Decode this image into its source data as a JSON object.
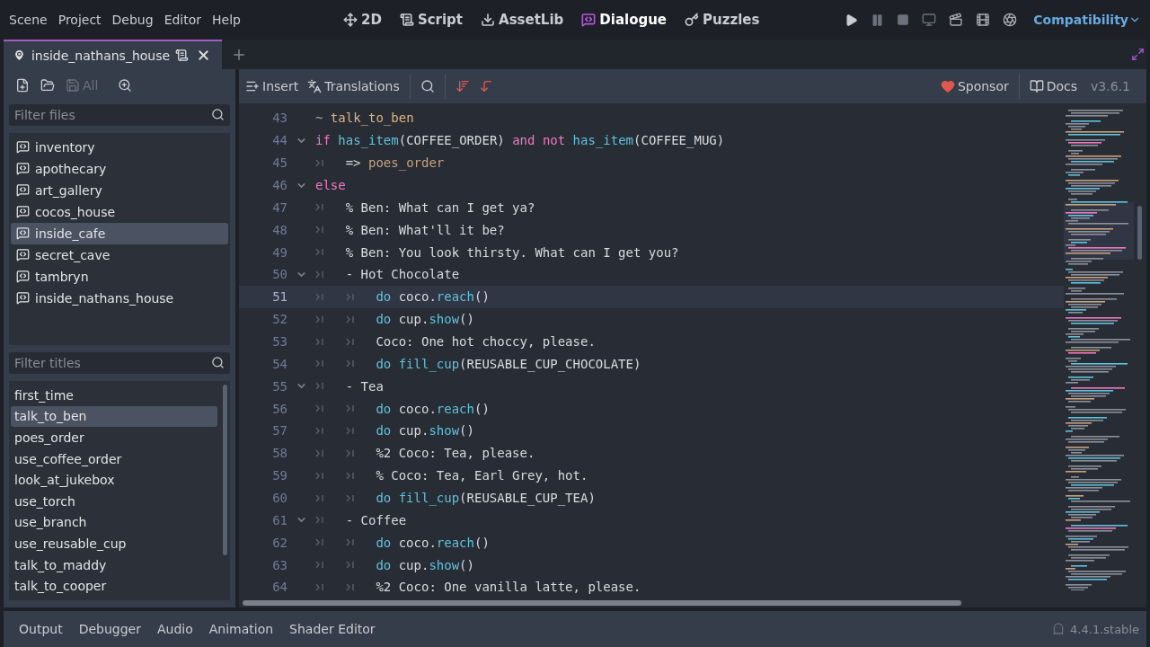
{
  "menu": [
    "Scene",
    "Project",
    "Debug",
    "Editor",
    "Help"
  ],
  "workspaces": [
    {
      "label": "2D",
      "kind": "plane",
      "selected": false
    },
    {
      "label": "Script",
      "kind": "script",
      "selected": false
    },
    {
      "label": "AssetLib",
      "kind": "assetlib",
      "selected": false
    },
    {
      "label": "Dialogue",
      "kind": "dialogue",
      "selected": true
    },
    {
      "label": "Puzzles",
      "kind": "puzzles",
      "selected": false
    }
  ],
  "renderer": "Compatibility",
  "open_tab": {
    "label": "inside_nathans_house"
  },
  "file_toolbar": {
    "save_all": {
      "label": "All",
      "disabled": true
    }
  },
  "files_filter": {
    "placeholder": "Filter files"
  },
  "files": [
    {
      "label": "inventory",
      "selected": false
    },
    {
      "label": "apothecary",
      "selected": false
    },
    {
      "label": "art_gallery",
      "selected": false
    },
    {
      "label": "cocos_house",
      "selected": false
    },
    {
      "label": "inside_cafe",
      "selected": true
    },
    {
      "label": "secret_cave",
      "selected": false
    },
    {
      "label": "tambryn",
      "selected": false
    },
    {
      "label": "inside_nathans_house",
      "selected": false
    }
  ],
  "titles_filter": {
    "placeholder": "Filter titles"
  },
  "titles": [
    {
      "label": "first_time",
      "selected": false
    },
    {
      "label": "talk_to_ben",
      "selected": true
    },
    {
      "label": "poes_order",
      "selected": false
    },
    {
      "label": "use_coffee_order",
      "selected": false
    },
    {
      "label": "look_at_jukebox",
      "selected": false
    },
    {
      "label": "use_torch",
      "selected": false
    },
    {
      "label": "use_branch",
      "selected": false
    },
    {
      "label": "use_reusable_cup",
      "selected": false
    },
    {
      "label": "talk_to_maddy",
      "selected": false
    },
    {
      "label": "talk_to_cooper",
      "selected": false
    }
  ],
  "editor_toolbar": {
    "insert": "Insert",
    "translations": "Translations",
    "sponsor": "Sponsor",
    "docs": "Docs",
    "version": "v3.6.1"
  },
  "lines": [
    {
      "number": "43",
      "foldable": false,
      "selected": false,
      "segments": [
        {
          "kind": "tilde",
          "text": "~ "
        },
        {
          "kind": "title",
          "text": "talk_to_ben"
        }
      ]
    },
    {
      "number": "44",
      "foldable": true,
      "selected": false,
      "segments": [
        {
          "kind": "kw",
          "text": "if "
        },
        {
          "kind": "fn",
          "text": "has_item"
        },
        {
          "kind": "text",
          "text": "(COFFEE_ORDER) "
        },
        {
          "kind": "kw",
          "text": "and not "
        },
        {
          "kind": "fn",
          "text": "has_item"
        },
        {
          "kind": "text",
          "text": "(COFFEE_MUG)"
        }
      ]
    },
    {
      "number": "45",
      "foldable": false,
      "selected": false,
      "segments": [
        {
          "kind": "tab"
        },
        {
          "kind": "text",
          "text": "=> "
        },
        {
          "kind": "goto",
          "text": "poes_order"
        }
      ]
    },
    {
      "number": "46",
      "foldable": true,
      "selected": false,
      "segments": [
        {
          "kind": "kw",
          "text": "else"
        }
      ]
    },
    {
      "number": "47",
      "foldable": false,
      "selected": false,
      "segments": [
        {
          "kind": "tab"
        },
        {
          "kind": "text",
          "text": "% Ben: What can I get ya?"
        }
      ]
    },
    {
      "number": "48",
      "foldable": false,
      "selected": false,
      "segments": [
        {
          "kind": "tab"
        },
        {
          "kind": "text",
          "text": "% Ben: What'll it be?"
        }
      ]
    },
    {
      "number": "49",
      "foldable": false,
      "selected": false,
      "segments": [
        {
          "kind": "tab"
        },
        {
          "kind": "text",
          "text": "% Ben: You look thirsty. What can I get you?"
        }
      ]
    },
    {
      "number": "50",
      "foldable": true,
      "selected": false,
      "segments": [
        {
          "kind": "tab"
        },
        {
          "kind": "text",
          "text": "- Hot Chocolate"
        }
      ]
    },
    {
      "number": "51",
      "foldable": false,
      "selected": true,
      "segments": [
        {
          "kind": "tab"
        },
        {
          "kind": "tab"
        },
        {
          "kind": "fn",
          "text": "do"
        },
        {
          "kind": "text",
          "text": " coco."
        },
        {
          "kind": "fn",
          "text": "reach"
        },
        {
          "kind": "text",
          "text": "()"
        }
      ]
    },
    {
      "number": "52",
      "foldable": false,
      "selected": false,
      "segments": [
        {
          "kind": "tab"
        },
        {
          "kind": "tab"
        },
        {
          "kind": "fn",
          "text": "do"
        },
        {
          "kind": "text",
          "text": " cup."
        },
        {
          "kind": "fn",
          "text": "show"
        },
        {
          "kind": "text",
          "text": "()"
        }
      ]
    },
    {
      "number": "53",
      "foldable": false,
      "selected": false,
      "segments": [
        {
          "kind": "tab"
        },
        {
          "kind": "tab"
        },
        {
          "kind": "text",
          "text": "Coco: One hot choccy, please."
        }
      ]
    },
    {
      "number": "54",
      "foldable": false,
      "selected": false,
      "segments": [
        {
          "kind": "tab"
        },
        {
          "kind": "tab"
        },
        {
          "kind": "fn",
          "text": "do fill_cup"
        },
        {
          "kind": "text",
          "text": "(REUSABLE_CUP_CHOCOLATE)"
        }
      ]
    },
    {
      "number": "55",
      "foldable": true,
      "selected": false,
      "segments": [
        {
          "kind": "tab"
        },
        {
          "kind": "text",
          "text": "- Tea"
        }
      ]
    },
    {
      "number": "56",
      "foldable": false,
      "selected": false,
      "segments": [
        {
          "kind": "tab"
        },
        {
          "kind": "tab"
        },
        {
          "kind": "fn",
          "text": "do"
        },
        {
          "kind": "text",
          "text": " coco."
        },
        {
          "kind": "fn",
          "text": "reach"
        },
        {
          "kind": "text",
          "text": "()"
        }
      ]
    },
    {
      "number": "57",
      "foldable": false,
      "selected": false,
      "segments": [
        {
          "kind": "tab"
        },
        {
          "kind": "tab"
        },
        {
          "kind": "fn",
          "text": "do"
        },
        {
          "kind": "text",
          "text": " cup."
        },
        {
          "kind": "fn",
          "text": "show"
        },
        {
          "kind": "text",
          "text": "()"
        }
      ]
    },
    {
      "number": "58",
      "foldable": false,
      "selected": false,
      "segments": [
        {
          "kind": "tab"
        },
        {
          "kind": "tab"
        },
        {
          "kind": "text",
          "text": "%2 Coco: Tea, please."
        }
      ]
    },
    {
      "number": "59",
      "foldable": false,
      "selected": false,
      "segments": [
        {
          "kind": "tab"
        },
        {
          "kind": "tab"
        },
        {
          "kind": "text",
          "text": "% Coco: Tea, Earl Grey, hot."
        }
      ]
    },
    {
      "number": "60",
      "foldable": false,
      "selected": false,
      "segments": [
        {
          "kind": "tab"
        },
        {
          "kind": "tab"
        },
        {
          "kind": "fn",
          "text": "do fill_cup"
        },
        {
          "kind": "text",
          "text": "(REUSABLE_CUP_TEA)"
        }
      ]
    },
    {
      "number": "61",
      "foldable": true,
      "selected": false,
      "segments": [
        {
          "kind": "tab"
        },
        {
          "kind": "text",
          "text": "- Coffee"
        }
      ]
    },
    {
      "number": "62",
      "foldable": false,
      "selected": false,
      "segments": [
        {
          "kind": "tab"
        },
        {
          "kind": "tab"
        },
        {
          "kind": "fn",
          "text": "do"
        },
        {
          "kind": "text",
          "text": " coco."
        },
        {
          "kind": "fn",
          "text": "reach"
        },
        {
          "kind": "text",
          "text": "()"
        }
      ]
    },
    {
      "number": "63",
      "foldable": false,
      "selected": false,
      "segments": [
        {
          "kind": "tab"
        },
        {
          "kind": "tab"
        },
        {
          "kind": "fn",
          "text": "do"
        },
        {
          "kind": "text",
          "text": " cup."
        },
        {
          "kind": "fn",
          "text": "show"
        },
        {
          "kind": "text",
          "text": "()"
        }
      ]
    },
    {
      "number": "64",
      "foldable": false,
      "selected": false,
      "segments": [
        {
          "kind": "tab"
        },
        {
          "kind": "tab"
        },
        {
          "kind": "text",
          "text": "%2 Coco: One vanilla latte, please."
        }
      ]
    }
  ],
  "bottom_tabs": [
    "Output",
    "Debugger",
    "Audio",
    "Animation",
    "Shader Editor"
  ],
  "engine_version": "4.4.1.stable"
}
